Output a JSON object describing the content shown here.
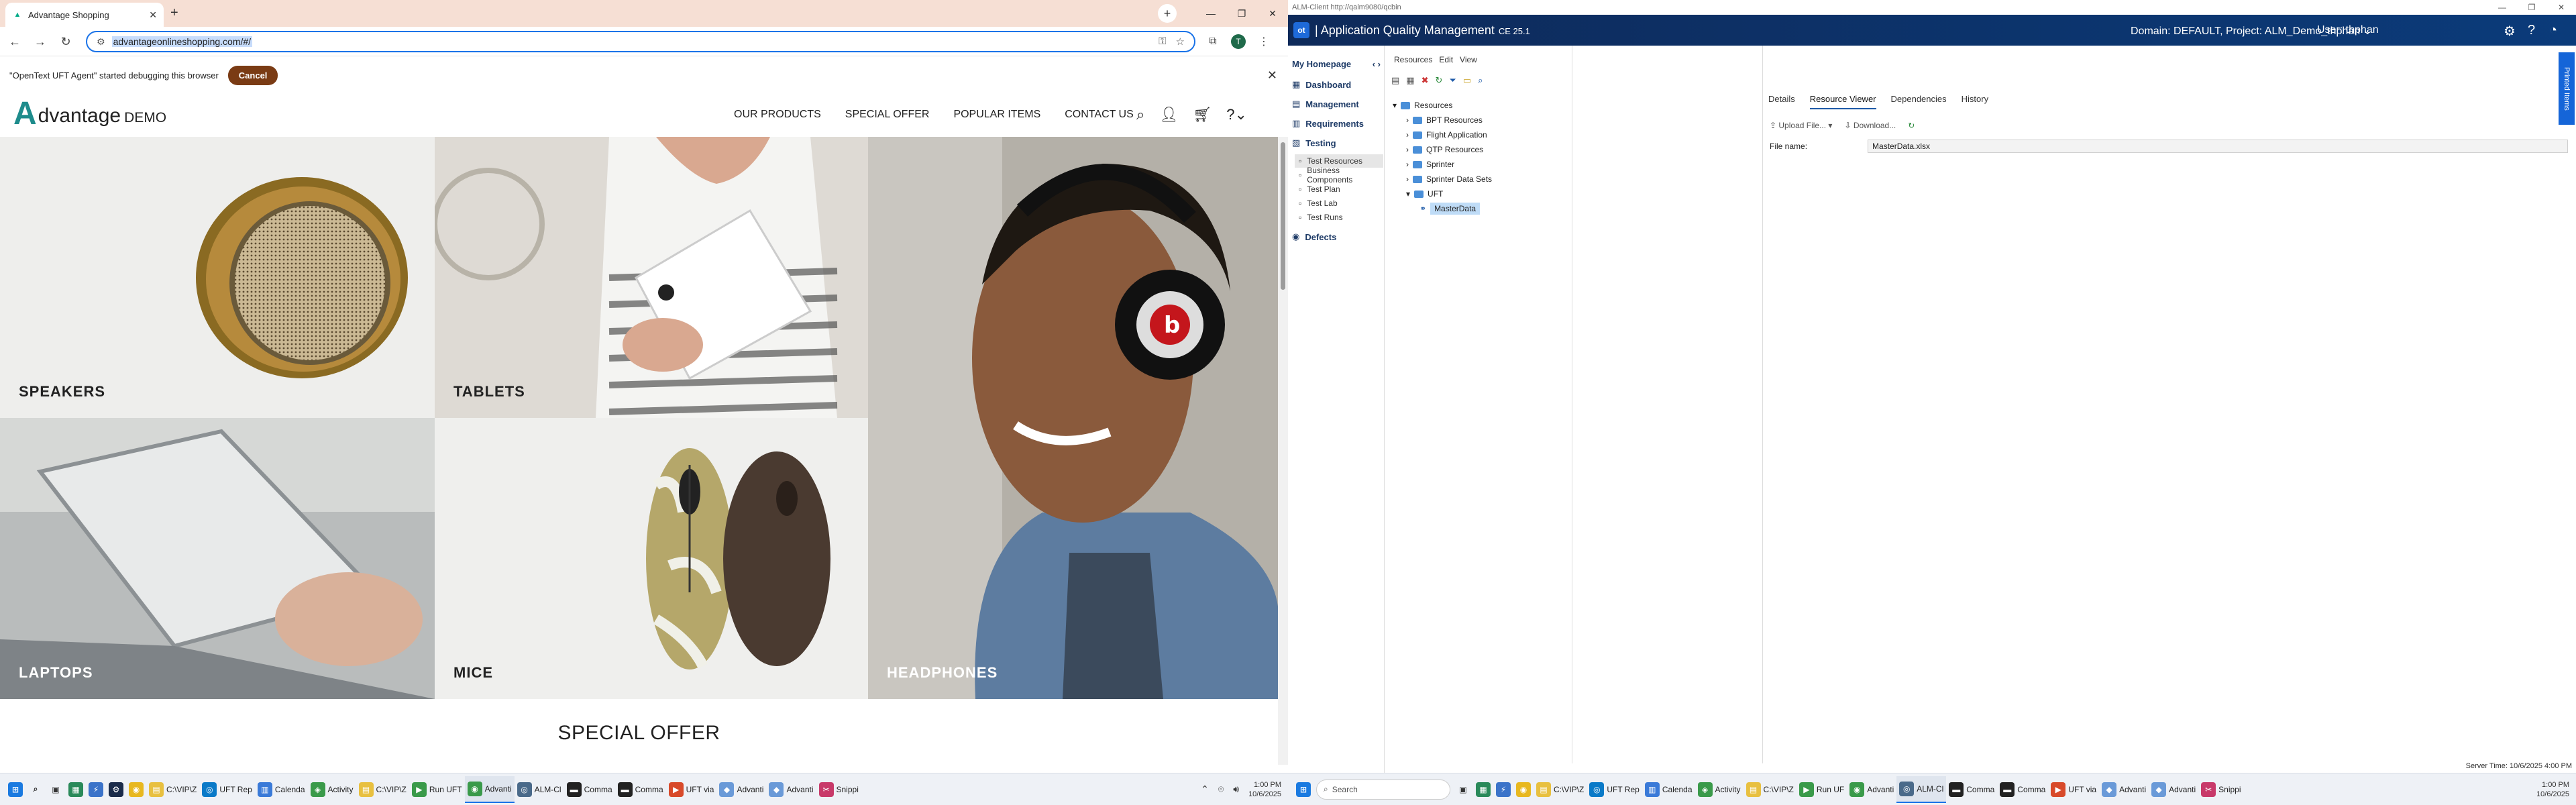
{
  "browser": {
    "tab_title": "Advantage Shopping",
    "url": "advantageonlineshopping.com/#/",
    "infobar_text": "\"OpenText UFT Agent\" started debugging this browser",
    "infobar_cancel": "Cancel",
    "avatar": "T"
  },
  "site": {
    "logo_letter": "A",
    "logo_text": "dvantage",
    "logo_demo": "DEMO",
    "nav": [
      "OUR PRODUCTS",
      "SPECIAL OFFER",
      "POPULAR ITEMS",
      "CONTACT US"
    ],
    "categories": [
      "SPEAKERS",
      "TABLETS",
      "HEADPHONES",
      "LAPTOPS",
      "MICE"
    ],
    "special_offer": "SPECIAL OFFER"
  },
  "taskbar_left": {
    "search_placeholder": "",
    "items": [
      "C:\\VIP\\Z",
      "UFT Rep",
      "Calenda",
      "Activity",
      "C:\\VIP\\Z",
      "Run UFT",
      "Advanti",
      "ALM-Cl",
      "Comma",
      "Comma",
      "UFT via",
      "Advanti",
      "Advanti",
      "Snippi"
    ],
    "time": "1:00 PM",
    "date": "10/6/2025"
  },
  "alm": {
    "window_title": "ALM-Client http://qalm9080/qcbin",
    "app_name": "Application Quality Management",
    "version": "CE 25.1",
    "domain_project": "Domain: DEFAULT, Project: ALM_Demo_thphan",
    "user": "User: thphan",
    "sidebar": {
      "home": "My Homepage",
      "items": [
        "Dashboard",
        "Management",
        "Requirements",
        "Testing"
      ],
      "testing_sub": [
        "Test Resources",
        "Business Components",
        "Test Plan",
        "Test Lab",
        "Test Runs"
      ],
      "defects": "Defects"
    },
    "menubar": [
      "Resources",
      "Edit",
      "View"
    ],
    "tree": {
      "root": "Resources",
      "children": [
        "BPT Resources",
        "Flight Application",
        "QTP Resources",
        "Sprinter",
        "Sprinter Data Sets",
        "UFT"
      ],
      "selected": "MasterData"
    },
    "tabs": [
      "Details",
      "Resource Viewer",
      "Dependencies",
      "History"
    ],
    "active_tab": "Resource Viewer",
    "toolbar": [
      "Upload File...",
      "Download..."
    ],
    "file_label": "File name:",
    "file_value": "MasterData.xlsx",
    "printed_items": "Printed Items",
    "server_time": "Server Time: 10/6/2025 4:00 PM"
  },
  "taskbar_right": {
    "search_placeholder": "Search",
    "items": [
      "C:\\VIP\\Z",
      "UFT Rep",
      "Calenda",
      "Activity",
      "C:\\VIP\\Z",
      "Run UF",
      "Advanti",
      "ALM-Cl",
      "Comma",
      "Comma",
      "UFT via",
      "Advanti",
      "Advanti",
      "Snippi"
    ],
    "time": "1:00 PM",
    "date": "10/6/2025"
  }
}
